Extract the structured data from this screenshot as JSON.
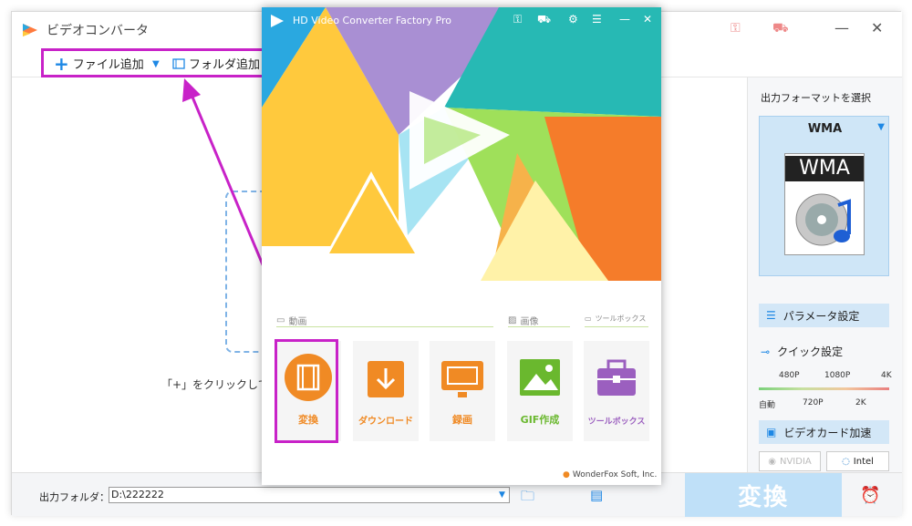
{
  "app": {
    "title": "ビデオコンバータ"
  },
  "toolbar": {
    "add_file_label": "ファイル追加",
    "add_folder_label": "フォルダ追加"
  },
  "main": {
    "hint": "「+」をクリックして"
  },
  "right_panel": {
    "title": "出力フォーマットを選択",
    "format_name": "WMA",
    "format_icon_text": "WMA",
    "param_button": "パラメータ設定",
    "quick_title": "クイック設定",
    "ticks_top": [
      "480P",
      "1080P",
      "4K"
    ],
    "ticks_bottom": [
      "自動",
      "720P",
      "2K"
    ],
    "gpu_button": "ビデオカード加速",
    "vendor_nvidia": "NVIDIA",
    "vendor_intel": "Intel"
  },
  "bottom": {
    "output_label": "出力フォルダ：",
    "output_path": "D:\\222222",
    "convert_label": "変換"
  },
  "launcher": {
    "title": "HD Video Converter Factory Pro",
    "section_video": "動画",
    "section_image": "画像",
    "section_toolbox": "ツールボックス",
    "tiles": [
      {
        "label": "変換",
        "color": "#f08a24"
      },
      {
        "label": "ダウンロード",
        "color": "#f08a24"
      },
      {
        "label": "録画",
        "color": "#f08a24"
      },
      {
        "label": "GIF作成",
        "color": "#6ab82e"
      },
      {
        "label": "ツールボックス",
        "color": "#9b5fbf"
      }
    ],
    "brand": "WonderFox Soft, Inc."
  },
  "colors": {
    "highlight": "#c822c8",
    "accent": "#1e88e5",
    "convert_bg": "#bfe0f8"
  }
}
